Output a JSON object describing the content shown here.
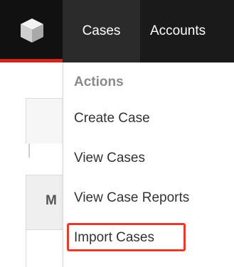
{
  "navbar": {
    "logo_icon": "cube-icon",
    "tabs": [
      {
        "label": "Cases"
      },
      {
        "label": "Accounts"
      }
    ],
    "accent_color": "#d0261d"
  },
  "background": {
    "panel_letter": "M"
  },
  "dropdown": {
    "heading": "Actions",
    "items": [
      {
        "label": "Create Case"
      },
      {
        "label": "View Cases"
      },
      {
        "label": "View Case Reports"
      },
      {
        "label": "Import Cases",
        "highlighted": true
      }
    ],
    "highlight_color": "#e33b2e"
  }
}
